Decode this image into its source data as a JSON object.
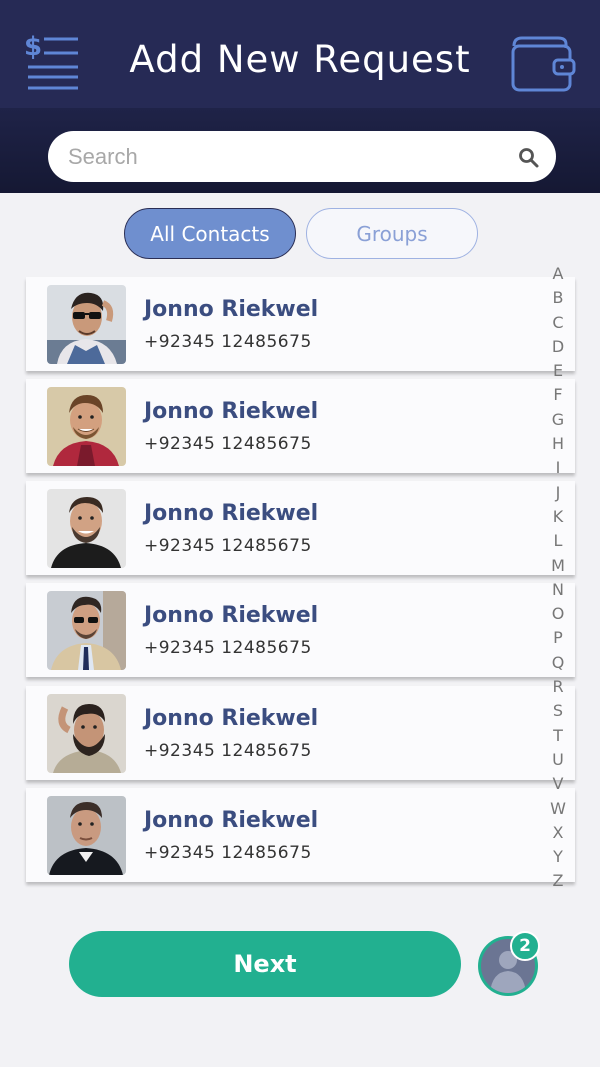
{
  "header": {
    "title": "Add New Request",
    "menu_icon": "dollar-list-icon",
    "wallet_icon": "wallet-icon"
  },
  "search": {
    "placeholder": "Search",
    "value": "",
    "icon": "search-icon"
  },
  "tabs": [
    {
      "label": "All Contacts",
      "active": true
    },
    {
      "label": "Groups",
      "active": false
    }
  ],
  "contacts": [
    {
      "name": "Jonno Riekwel",
      "phone": "+92345 12485675"
    },
    {
      "name": "Jonno Riekwel",
      "phone": "+92345 12485675"
    },
    {
      "name": "Jonno Riekwel",
      "phone": "+92345 12485675"
    },
    {
      "name": "Jonno Riekwel",
      "phone": "+92345 12485675"
    },
    {
      "name": "Jonno Riekwel",
      "phone": "+92345 12485675"
    },
    {
      "name": "Jonno Riekwel",
      "phone": "+92345 12485675"
    }
  ],
  "alphabet": [
    "A",
    "B",
    "C",
    "D",
    "E",
    "F",
    "G",
    "H",
    "I",
    "J",
    "K",
    "L",
    "M",
    "N",
    "O",
    "P",
    "Q",
    "R",
    "S",
    "T",
    "U",
    "V",
    "W",
    "X",
    "Y",
    "Z"
  ],
  "footer": {
    "next_label": "Next",
    "selected_count": "2"
  },
  "colors": {
    "header_bg": "#262a55",
    "accent_green": "#22b090",
    "tab_active": "#6f8fcf",
    "name_text": "#3b4d80"
  }
}
